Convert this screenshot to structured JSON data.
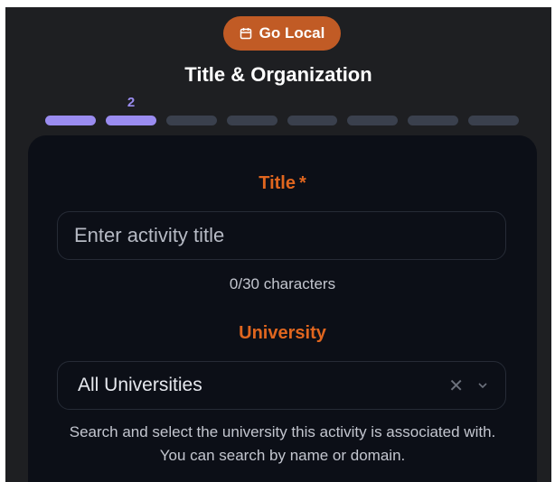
{
  "header": {
    "badge_label": "Go Local",
    "badge_icon": "calendar-icon",
    "badge_color": "#c15b25",
    "title": "Title & Organization"
  },
  "progress": {
    "current_step": "2",
    "total_steps": 8,
    "completed_steps": 2,
    "active_color": "#9a8cf0"
  },
  "form": {
    "title_field": {
      "label": "Title",
      "required_marker": "*",
      "placeholder": "Enter activity title",
      "value": "",
      "char_counter": "0/30 characters"
    },
    "university_field": {
      "label": "University",
      "selected_value": "All Universities",
      "clear_icon": "close-icon",
      "dropdown_icon": "chevron-down-icon",
      "help_text": "Search and select the university this activity is associated with. You can search by name or domain."
    },
    "label_color": "#e0661f"
  }
}
